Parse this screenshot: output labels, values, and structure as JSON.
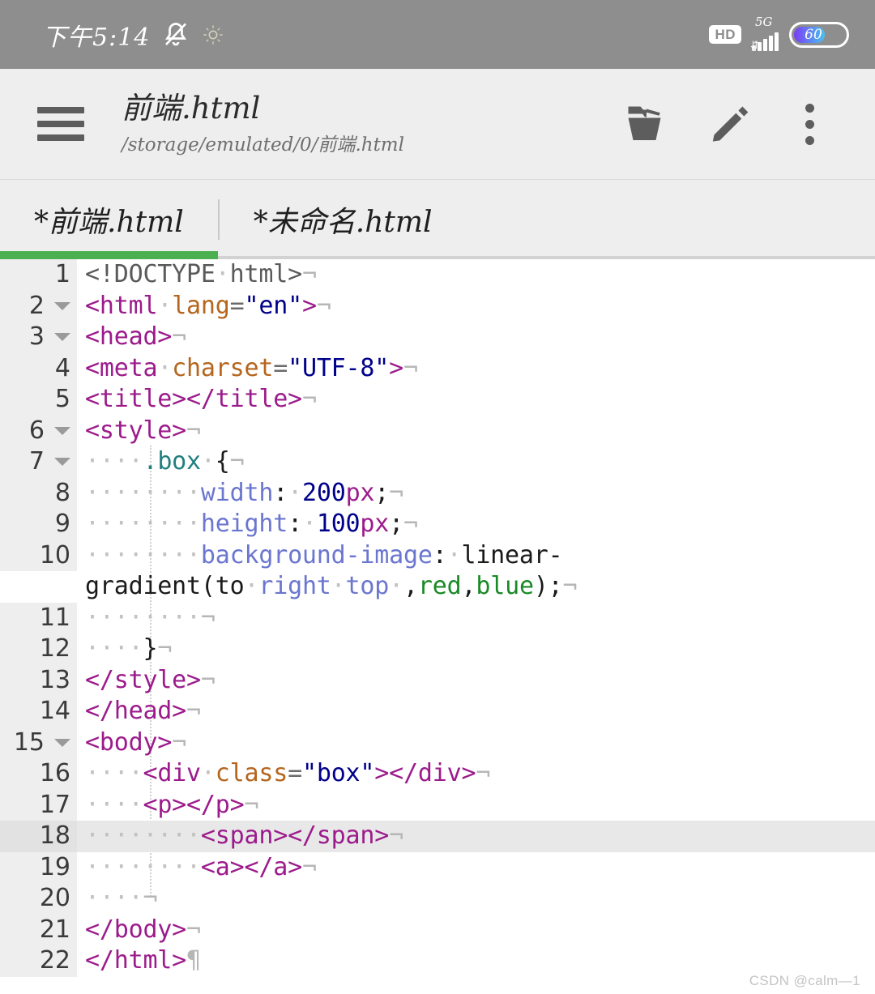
{
  "status_bar": {
    "time": "下午5:14",
    "bell_icon": "bell-muted-icon",
    "sparkle_icon": "sparkle-icon",
    "hd_label": "HD",
    "network_label": "5G",
    "signal_icon": "signal-bars-icon",
    "battery_level": "60",
    "battery_percent": 60,
    "background_color": "#8e8e8e"
  },
  "header": {
    "menu_icon": "hamburger-menu-icon",
    "file_name": "前端.html",
    "file_path": "/storage/emulated/0/前端.html",
    "open_icon": "open-folder-icon",
    "edit_icon": "pencil-edit-icon",
    "overflow_icon": "more-vertical-icon",
    "background_color": "#eeeeee"
  },
  "tabs": {
    "active_index": 0,
    "active_color": "#4caf50",
    "items": [
      {
        "label": "*前端.html"
      },
      {
        "label": "*未命名.html"
      }
    ]
  },
  "editor": {
    "current_line": 18,
    "total_lines": 22,
    "lines": [
      {
        "n": "1",
        "fold": false,
        "tokens": [
          {
            "c": "t-doctype",
            "t": "<!DOCTYPE"
          },
          {
            "c": "ws",
            "t": "·"
          },
          {
            "c": "t-doctype",
            "t": "html>"
          },
          {
            "c": "eol",
            "t": "¬"
          }
        ]
      },
      {
        "n": "2",
        "fold": true,
        "tokens": [
          {
            "c": "t-tag",
            "t": "<html"
          },
          {
            "c": "ws",
            "t": "·"
          },
          {
            "c": "t-attr",
            "t": "lang"
          },
          {
            "c": "t-eq",
            "t": "="
          },
          {
            "c": "t-val",
            "t": "\"en\""
          },
          {
            "c": "t-tag",
            "t": ">"
          },
          {
            "c": "eol",
            "t": "¬"
          }
        ]
      },
      {
        "n": "3",
        "fold": true,
        "tokens": [
          {
            "c": "t-tag",
            "t": "<head>"
          },
          {
            "c": "eol",
            "t": "¬"
          }
        ]
      },
      {
        "n": "4",
        "fold": false,
        "tokens": [
          {
            "c": "t-tag",
            "t": "<meta"
          },
          {
            "c": "ws",
            "t": "·"
          },
          {
            "c": "t-attr",
            "t": "charset"
          },
          {
            "c": "t-eq",
            "t": "="
          },
          {
            "c": "t-val",
            "t": "\"UTF-8\""
          },
          {
            "c": "t-tag",
            "t": ">"
          },
          {
            "c": "eol",
            "t": "¬"
          }
        ]
      },
      {
        "n": "5",
        "fold": false,
        "tokens": [
          {
            "c": "t-tag",
            "t": "<title></title>"
          },
          {
            "c": "eol",
            "t": "¬"
          }
        ]
      },
      {
        "n": "6",
        "fold": true,
        "tokens": [
          {
            "c": "t-tag",
            "t": "<style>"
          },
          {
            "c": "eol",
            "t": "¬"
          }
        ]
      },
      {
        "n": "7",
        "fold": true,
        "tokens": [
          {
            "c": "ws",
            "t": "····"
          },
          {
            "c": "t-sel",
            "t": ".box"
          },
          {
            "c": "ws",
            "t": "·"
          },
          {
            "c": "t-punc",
            "t": "{"
          },
          {
            "c": "eol",
            "t": "¬"
          }
        ]
      },
      {
        "n": "8",
        "fold": false,
        "tokens": [
          {
            "c": "ws",
            "t": "········"
          },
          {
            "c": "t-prop",
            "t": "width"
          },
          {
            "c": "t-punc",
            "t": ":"
          },
          {
            "c": "ws",
            "t": "·"
          },
          {
            "c": "t-num",
            "t": "200"
          },
          {
            "c": "t-unit",
            "t": "px"
          },
          {
            "c": "t-punc",
            "t": ";"
          },
          {
            "c": "eol",
            "t": "¬"
          }
        ]
      },
      {
        "n": "9",
        "fold": false,
        "tokens": [
          {
            "c": "ws",
            "t": "········"
          },
          {
            "c": "t-prop",
            "t": "height"
          },
          {
            "c": "t-punc",
            "t": ":"
          },
          {
            "c": "ws",
            "t": "·"
          },
          {
            "c": "t-num",
            "t": "100"
          },
          {
            "c": "t-unit",
            "t": "px"
          },
          {
            "c": "t-punc",
            "t": ";"
          },
          {
            "c": "eol",
            "t": "¬"
          }
        ]
      },
      {
        "n": "10",
        "fold": false,
        "wrap": true,
        "tokens": [
          {
            "c": "ws",
            "t": "········"
          },
          {
            "c": "t-prop",
            "t": "background-image"
          },
          {
            "c": "t-punc",
            "t": ":"
          },
          {
            "c": "ws",
            "t": "·"
          },
          {
            "c": "t-plain",
            "t": "linear-gradient(to"
          },
          {
            "c": "ws",
            "t": "·"
          },
          {
            "c": "t-prop",
            "t": "right"
          },
          {
            "c": "ws",
            "t": "·"
          },
          {
            "c": "t-prop",
            "t": "top"
          },
          {
            "c": "ws",
            "t": "·"
          },
          {
            "c": "t-punc",
            "t": ","
          },
          {
            "c": "t-kw",
            "t": "red"
          },
          {
            "c": "t-punc",
            "t": ","
          },
          {
            "c": "t-kw",
            "t": "blue"
          },
          {
            "c": "t-punc",
            "t": ");"
          },
          {
            "c": "eol",
            "t": "¬"
          }
        ]
      },
      {
        "n": "11",
        "fold": false,
        "tokens": [
          {
            "c": "ws",
            "t": "········"
          },
          {
            "c": "eol",
            "t": "¬"
          }
        ]
      },
      {
        "n": "12",
        "fold": false,
        "tokens": [
          {
            "c": "ws",
            "t": "····"
          },
          {
            "c": "t-punc",
            "t": "}"
          },
          {
            "c": "eol",
            "t": "¬"
          }
        ]
      },
      {
        "n": "13",
        "fold": false,
        "tokens": [
          {
            "c": "t-tag",
            "t": "</style>"
          },
          {
            "c": "eol",
            "t": "¬"
          }
        ]
      },
      {
        "n": "14",
        "fold": false,
        "tokens": [
          {
            "c": "t-tag",
            "t": "</head>"
          },
          {
            "c": "eol",
            "t": "¬"
          }
        ]
      },
      {
        "n": "15",
        "fold": true,
        "tokens": [
          {
            "c": "t-tag",
            "t": "<body>"
          },
          {
            "c": "eol",
            "t": "¬"
          }
        ]
      },
      {
        "n": "16",
        "fold": false,
        "tokens": [
          {
            "c": "ws",
            "t": "····"
          },
          {
            "c": "t-tag",
            "t": "<div"
          },
          {
            "c": "ws",
            "t": "·"
          },
          {
            "c": "t-attr",
            "t": "class"
          },
          {
            "c": "t-eq",
            "t": "="
          },
          {
            "c": "t-val",
            "t": "\"box\""
          },
          {
            "c": "t-tag",
            "t": "></div>"
          },
          {
            "c": "eol",
            "t": "¬"
          }
        ]
      },
      {
        "n": "17",
        "fold": false,
        "tokens": [
          {
            "c": "ws",
            "t": "····"
          },
          {
            "c": "t-tag",
            "t": "<p></p>"
          },
          {
            "c": "eol",
            "t": "¬"
          }
        ]
      },
      {
        "n": "18",
        "fold": false,
        "current": true,
        "tokens": [
          {
            "c": "ws",
            "t": "········"
          },
          {
            "c": "t-tag",
            "t": "<span></span>"
          },
          {
            "c": "eol",
            "t": "¬"
          }
        ]
      },
      {
        "n": "19",
        "fold": false,
        "tokens": [
          {
            "c": "ws",
            "t": "········"
          },
          {
            "c": "t-tag",
            "t": "<a></a>"
          },
          {
            "c": "eol",
            "t": "¬"
          }
        ]
      },
      {
        "n": "20",
        "fold": false,
        "tokens": [
          {
            "c": "ws",
            "t": "····"
          },
          {
            "c": "eol",
            "t": "¬"
          }
        ]
      },
      {
        "n": "21",
        "fold": false,
        "tokens": [
          {
            "c": "t-tag",
            "t": "</body>"
          },
          {
            "c": "eol",
            "t": "¬"
          }
        ]
      },
      {
        "n": "22",
        "fold": false,
        "tokens": [
          {
            "c": "t-tag",
            "t": "</html>"
          },
          {
            "c": "eol",
            "t": "¶"
          }
        ]
      }
    ]
  },
  "watermark": "CSDN @calm—1"
}
